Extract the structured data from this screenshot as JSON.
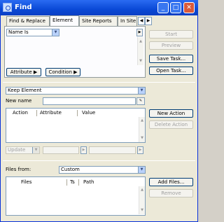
{
  "window": {
    "title": "Find"
  },
  "tabs": [
    {
      "label": "Find & Replace"
    },
    {
      "label": "Element"
    },
    {
      "label": "Site Reports"
    },
    {
      "label": "In Site"
    }
  ],
  "top": {
    "scope_select": "Name Is",
    "start_button": "Start",
    "preview_button": "Preview",
    "save_task_button": "Save Task...",
    "open_task_button": "Open Task...",
    "attribute_button": "Attribute",
    "condition_button": "Condition"
  },
  "middle": {
    "action_select": "Keep Element",
    "new_name_label": "New name",
    "columns": [
      "Action",
      "Attribute",
      "Value"
    ],
    "new_action_button": "New Action",
    "delete_action_button": "Delete Action",
    "update_select": "Update"
  },
  "bottom": {
    "files_from_label": "Files from:",
    "files_from_select": "Custom",
    "columns": [
      "Files",
      "Ts",
      "Path"
    ],
    "add_files_button": "Add Files...",
    "remove_button": "Remove"
  },
  "colors": {
    "titlebar": "#0a49d6",
    "window_bg": "#ece9d8"
  }
}
